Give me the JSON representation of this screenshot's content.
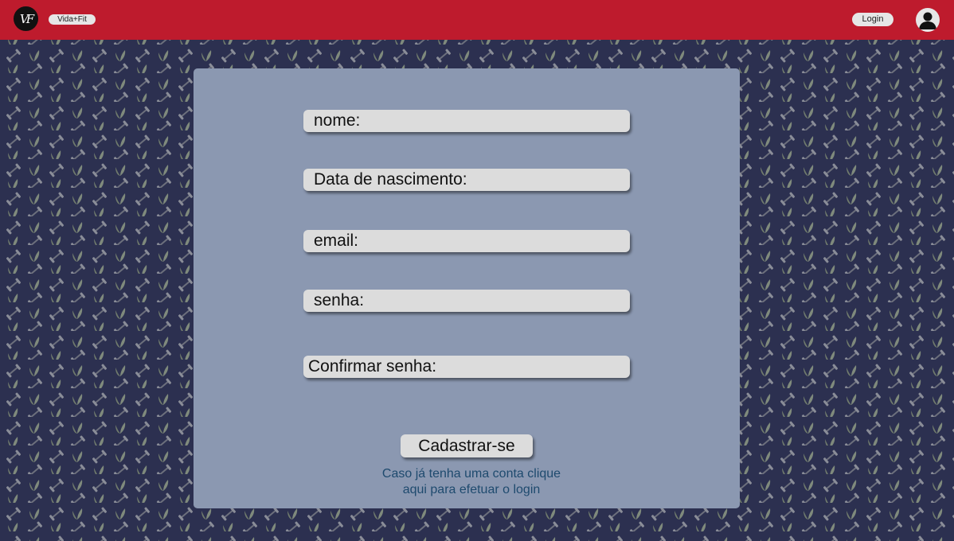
{
  "header": {
    "logo_text": "VF",
    "brand": "Vida+Fit",
    "login_label": "Login",
    "avatar_icon": "user-avatar-icon"
  },
  "form": {
    "nome_label": "nome:",
    "birth_label": "Data de nascimento:",
    "email_label": "email:",
    "password_label": "senha:",
    "confirm_label": "Confirmar senha:",
    "submit_label": "Cadastrar-se",
    "hint_line1": "Caso já tenha uma conta clique",
    "hint_line2": "aqui para efetuar o login"
  },
  "colors": {
    "topbar": "#be1b2d",
    "background": "#2c3050",
    "card": "#8b98b1",
    "field": "#dcdcdc",
    "hint_text": "#1e4a6e"
  },
  "background_pattern_icons": [
    "leaf-icon",
    "dumbbell-icon"
  ]
}
